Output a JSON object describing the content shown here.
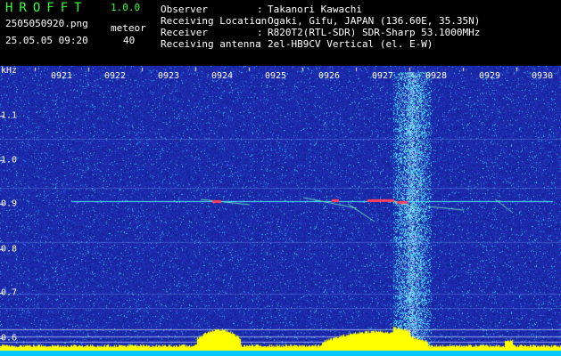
{
  "app": {
    "title": "HROFFT",
    "version": "1.0.0"
  },
  "file": {
    "name": "2505050920.png",
    "datetime": "25.05.05 09:20"
  },
  "detection": {
    "label": "meteor",
    "count": "40"
  },
  "station": {
    "rows": [
      {
        "label": "Observer",
        "value": "Takanori Kawachi"
      },
      {
        "label": "Receiving Location",
        "value": "Ogaki, Gifu, JAPAN (136.60E, 35.35N)"
      },
      {
        "label": "Receiver",
        "value": "R820T2(RTL-SDR) SDR-Sharp 53.1000MHz"
      },
      {
        "label": "Receiving antenna",
        "value": "2el-HB9CV Vertical (el. E-W)"
      }
    ]
  },
  "spectrogram": {
    "unit": "kHz",
    "time_ticks": [
      "0921",
      "0922",
      "0923",
      "0924",
      "0925",
      "0926",
      "0927",
      "0928",
      "0929",
      "0930"
    ],
    "freq_ticks": [
      "1.1",
      "1.0",
      "0.9",
      "0.8",
      "0.7",
      "0.6"
    ],
    "colors": {
      "background": "#1a2aa8",
      "tick": "#ffffff",
      "carrier": "#55e8ff",
      "burst": "#ff4060",
      "level_fill": "#ffff00",
      "level_base": "#00c8ff"
    }
  }
}
